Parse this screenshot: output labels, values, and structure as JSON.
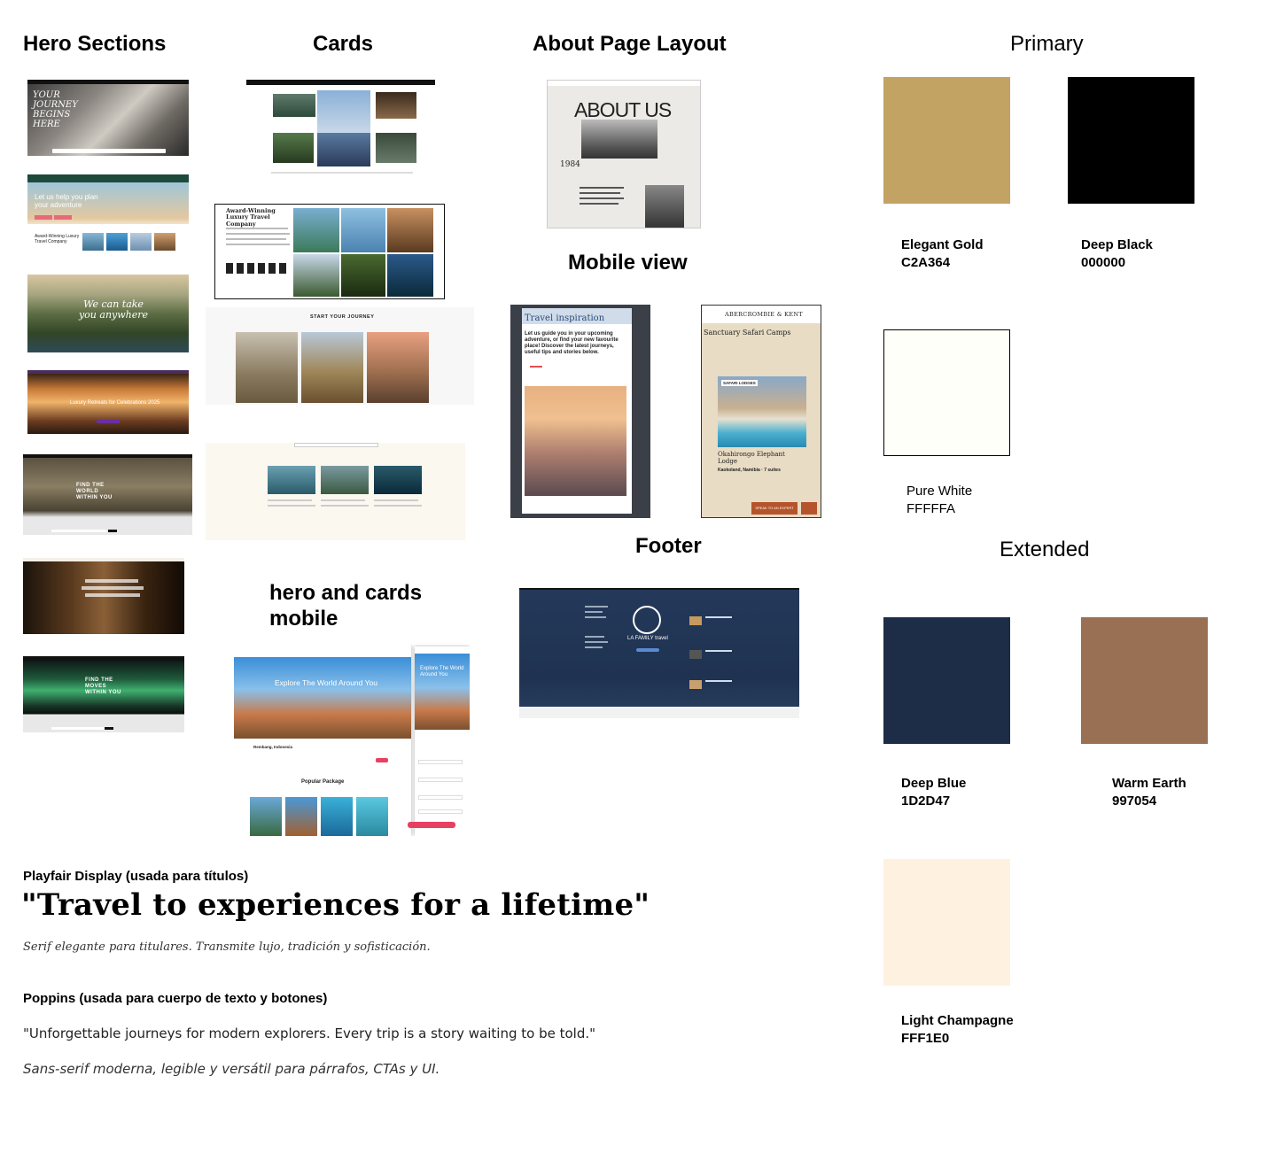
{
  "sections": {
    "hero": "Hero Sections",
    "cards": "Cards",
    "about": "About Page Layout",
    "mobile": "Mobile view",
    "footer": "Footer",
    "hero_cards_mobile_1": "hero and cards",
    "hero_cards_mobile_2": "mobile",
    "primary": "Primary",
    "extended": "Extended"
  },
  "colors": {
    "primary": [
      {
        "name": "Elegant Gold",
        "hex": "C2A364",
        "value": "#C2A364"
      },
      {
        "name": "Deep Black",
        "hex": "000000",
        "value": "#000000"
      },
      {
        "name": "Pure White",
        "hex": "FFFFFA",
        "value": "#FFFFFA"
      }
    ],
    "extended": [
      {
        "name": "Deep Blue",
        "hex": "1D2D47",
        "value": "#1D2D47"
      },
      {
        "name": "Warm Earth",
        "hex": "997054",
        "value": "#997054"
      },
      {
        "name": "Light Champagne",
        "hex": "FFF1E0",
        "value": "#FFF1E0"
      }
    ]
  },
  "typography": {
    "serif_label": "Playfair Display (usada para títulos)",
    "serif_sample": "\"Travel to experiences for a lifetime\"",
    "serif_note": "Serif elegante para titulares. Transmite lujo, tradición y sofisticación.",
    "sans_label": "Poppins (usada para cuerpo de texto y botones)",
    "sans_sample": "\"Unforgettable journeys for modern explorers. Every trip is a story waiting to be told.\"",
    "sans_note": "Sans-serif moderna, legible y versátil para párrafos, CTAs y UI."
  },
  "thumbs": {
    "hero1_text": "YOUR JOURNEY BEGINS HERE",
    "hero2_text": "Let us help you plan your adventure",
    "hero2_sub": "Award-Winning Luxury Travel Company",
    "hero3_text": "We can take you anywhere",
    "hero4_text": "Luxury Retreats for Celebrations 2025",
    "hero5_text": "FIND THE WORLD WITHIN YOU",
    "hero7_text": "FIND THE MOVES WITHIN YOU",
    "cards2_title": "Award-Winning Luxury Travel Company",
    "cards3_title": "START YOUR JOURNEY",
    "about_title": "ABOUT US",
    "about_year": "1984",
    "mobile1_title": "Travel inspiration",
    "mobile1_body": "Let us guide you in your upcoming adventure, or find your new favourite place! Discover the latest journeys, useful tips and stories below.",
    "mobile2_brand": "ABERCROMBIE & KENT",
    "mobile2_title": "Sanctuary Safari Camps",
    "mobile2_tag": "SAFARI LODGES",
    "mobile2_card": "Okahirongo Elephant Lodge",
    "mobile2_loc": "Kaokoland, Namibia · 7 suites",
    "mobile2_btn": "SPEAK TO AN EXPERT",
    "footer_brand": "LA FAMILY travel",
    "hcm_title": "Explore The World Around You",
    "hcm_popular": "Popular Package",
    "hcm_location": "Rembang, Indonesia",
    "hcm_mobile_title": "Explore The World Around You"
  }
}
